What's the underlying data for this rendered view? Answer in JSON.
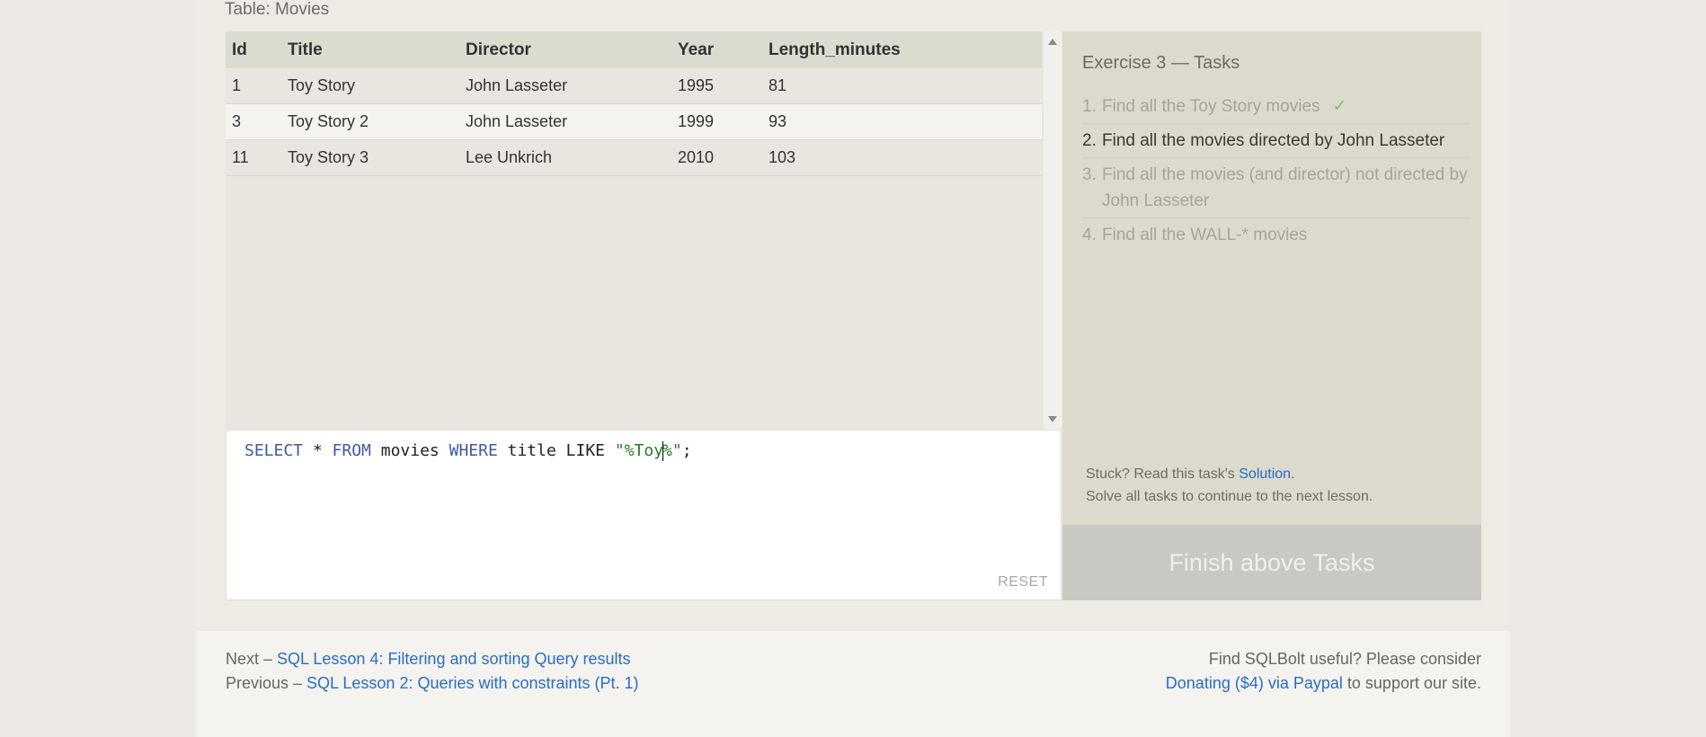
{
  "table_title": "Table: Movies",
  "results": {
    "columns": [
      "Id",
      "Title",
      "Director",
      "Year",
      "Length_minutes"
    ],
    "rows": [
      [
        "1",
        "Toy Story",
        "John Lasseter",
        "1995",
        "81"
      ],
      [
        "3",
        "Toy Story 2",
        "John Lasseter",
        "1999",
        "93"
      ],
      [
        "11",
        "Toy Story 3",
        "Lee Unkrich",
        "2010",
        "103"
      ]
    ]
  },
  "editor": {
    "code": {
      "select": "SELECT",
      "star": " * ",
      "from": "FROM",
      "table": " movies ",
      "where": "WHERE",
      "rest": " title LIKE ",
      "string_before_cursor": "\"%Toy",
      "string_after_cursor": "%\"",
      "end": ";"
    },
    "reset_label": "RESET"
  },
  "tasks": {
    "heading": "Exercise 3 — Tasks",
    "items": [
      {
        "num": "1.",
        "text": "Find all the Toy Story movies",
        "done": "✓"
      },
      {
        "num": "2.",
        "text": "Find all the movies directed by John Lasseter"
      },
      {
        "num": "3.",
        "text": "Find all the movies (and director) not directed by John Lasseter"
      },
      {
        "num": "4.",
        "text": "Find all the WALL-* movies"
      }
    ],
    "stuck_prefix": "Stuck? Read this task's ",
    "solution_link": "Solution",
    "stuck_suffix": ".",
    "solve_all": "Solve all tasks to continue to the next lesson.",
    "finish_label": "Finish above Tasks"
  },
  "footer": {
    "next_prefix": "Next – ",
    "next_link": "SQL Lesson 4: Filtering and sorting Query results",
    "prev_prefix": "Previous – ",
    "prev_link": "SQL Lesson 2: Queries with constraints (Pt. 1)",
    "useful_text": "Find SQLBolt useful? Please consider",
    "donate_link": "Donating ($4) via Paypal",
    "donate_suffix": " to support our site."
  }
}
